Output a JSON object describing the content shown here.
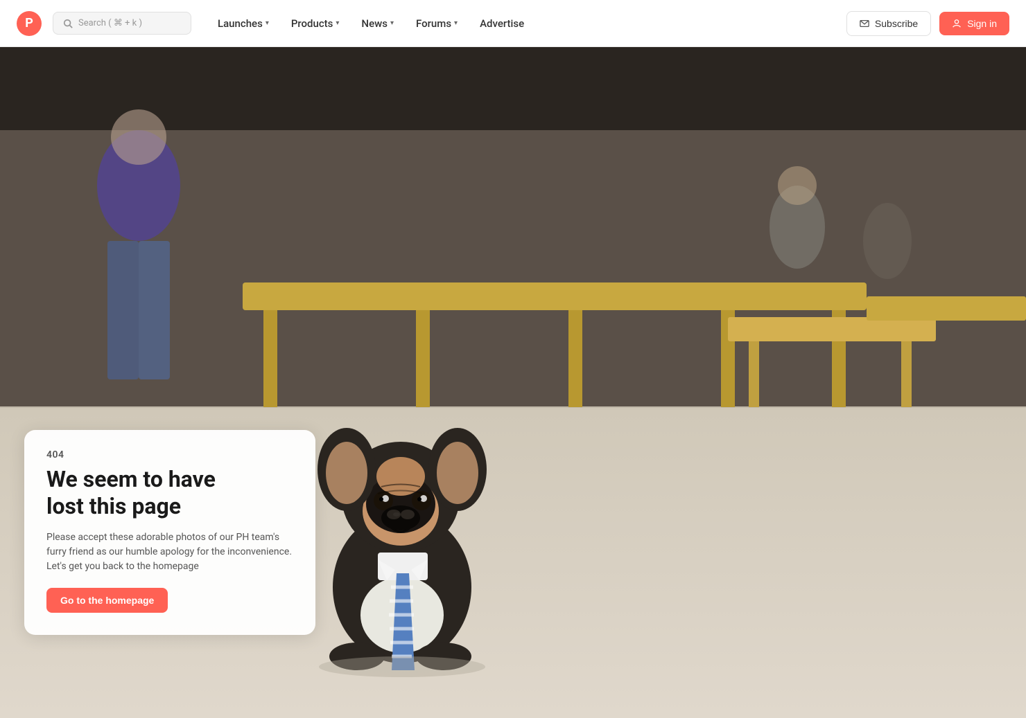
{
  "navbar": {
    "logo_letter": "P",
    "search_placeholder": "Search ( ⌘ + k )",
    "nav_items": [
      {
        "id": "launches",
        "label": "Launches",
        "has_dropdown": true
      },
      {
        "id": "products",
        "label": "Products",
        "has_dropdown": true
      },
      {
        "id": "news",
        "label": "News",
        "has_dropdown": true
      },
      {
        "id": "forums",
        "label": "Forums",
        "has_dropdown": true
      },
      {
        "id": "advertise",
        "label": "Advertise",
        "has_dropdown": false
      }
    ],
    "subscribe_label": "Subscribe",
    "signin_label": "Sign in"
  },
  "error_page": {
    "code": "404",
    "title_line1": "We seem to have",
    "title_line2": "lost this page",
    "description": "Please accept these adorable photos of our PH team's furry friend as our humble apology for the inconvenience. Let's get you back to the homepage",
    "cta_label": "Go to the homepage"
  },
  "colors": {
    "brand": "#ff6154",
    "nav_bg": "#ffffff",
    "card_bg": "rgba(255,255,255,0.95)"
  }
}
